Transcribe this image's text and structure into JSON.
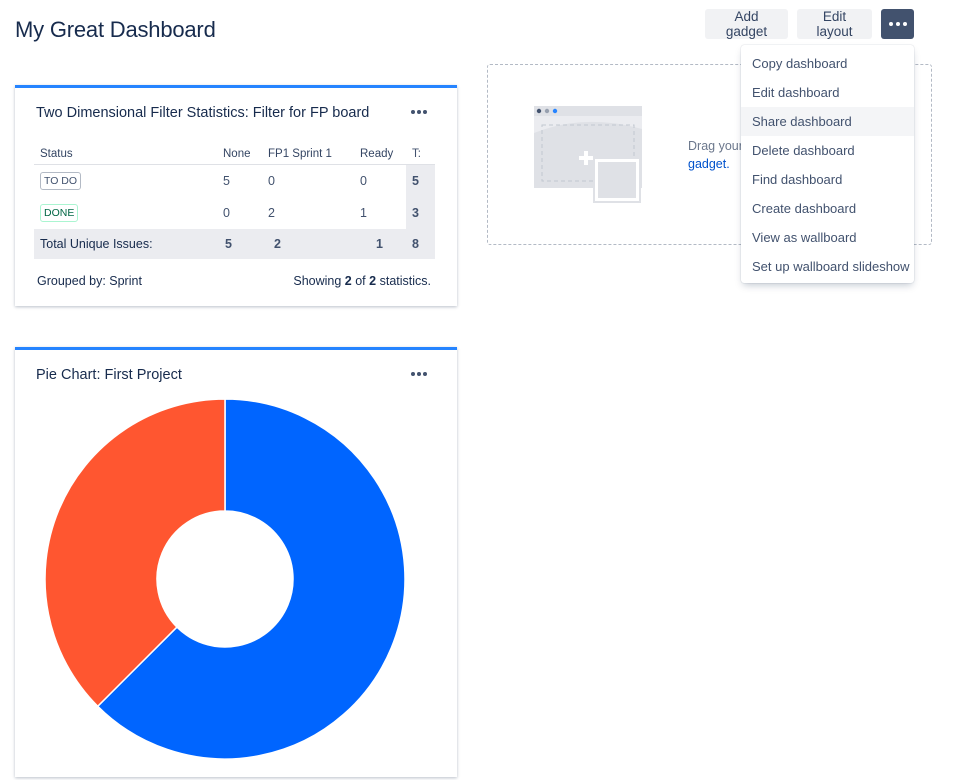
{
  "page": {
    "title": "My Great Dashboard"
  },
  "toolbar": {
    "add_gadget": "Add gadget",
    "edit_layout": "Edit layout",
    "more_icon": "more-horizontal-icon"
  },
  "dropdown": {
    "items": [
      {
        "label": "Copy dashboard"
      },
      {
        "label": "Edit dashboard"
      },
      {
        "label": "Share dashboard"
      },
      {
        "label": "Delete dashboard"
      },
      {
        "label": "Find dashboard"
      },
      {
        "label": "Create dashboard"
      },
      {
        "label": "View as wallboard"
      },
      {
        "label": "Set up wallboard slideshow"
      }
    ],
    "highlighted": "Share dashboard"
  },
  "drop_zone": {
    "text": "Drag your",
    "link": "gadget."
  },
  "stats_gadget": {
    "title": "Two Dimensional Filter Statistics: Filter for FP board",
    "headers": [
      "Status",
      "None",
      "FP1 Sprint 1",
      "Ready",
      "T:"
    ],
    "rows": [
      {
        "status": "TO DO",
        "none": "5",
        "sprint": "0",
        "ready": "0",
        "total": "5"
      },
      {
        "status": "DONE",
        "none": "0",
        "sprint": "2",
        "ready": "1",
        "total": "3"
      }
    ],
    "total_row": {
      "label": "Total Unique Issues:",
      "none": "5",
      "sprint": "2",
      "ready": "1",
      "total": "8"
    },
    "grouped_by": "Grouped by: Sprint",
    "showing_prefix": "Showing",
    "showing_shown": "2",
    "showing_of": "of",
    "showing_total": "2",
    "showing_suffix": "statistics."
  },
  "pie_gadget": {
    "title": "Pie Chart: First Project"
  },
  "colors": {
    "accent": "#2684ff",
    "primary_button": "#42526e",
    "link": "#0052cc"
  },
  "chart_data": {
    "type": "pie",
    "title": "",
    "slices": [
      {
        "value": 5,
        "color": "#0065ff"
      },
      {
        "value": 3,
        "color": "#ff5630"
      }
    ]
  }
}
